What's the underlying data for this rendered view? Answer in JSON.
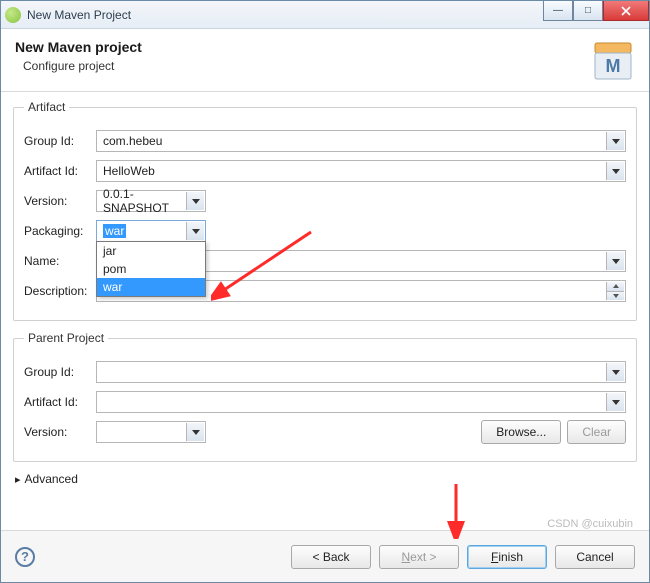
{
  "window": {
    "title": "New Maven Project"
  },
  "header": {
    "title": "New Maven project",
    "subtitle": "Configure project"
  },
  "artifact": {
    "legend": "Artifact",
    "group_id_label": "Group Id:",
    "group_id_value": "com.hebeu",
    "artifact_id_label": "Artifact Id:",
    "artifact_id_value": "HelloWeb",
    "version_label": "Version:",
    "version_value": "0.0.1-SNAPSHOT",
    "packaging_label": "Packaging:",
    "packaging_value": "war",
    "packaging_options": [
      "jar",
      "pom",
      "war"
    ],
    "name_label": "Name:",
    "name_value": "",
    "description_label": "Description:",
    "description_value": ""
  },
  "parent": {
    "legend": "Parent Project",
    "group_id_label": "Group Id:",
    "artifact_id_label": "Artifact Id:",
    "version_label": "Version:",
    "browse_label": "Browse...",
    "clear_label": "Clear"
  },
  "advanced_label": "Advanced",
  "footer": {
    "back": "< Back",
    "next": "Next >",
    "finish": "Finish",
    "cancel": "Cancel"
  },
  "watermark": "CSDN @cuixubin"
}
